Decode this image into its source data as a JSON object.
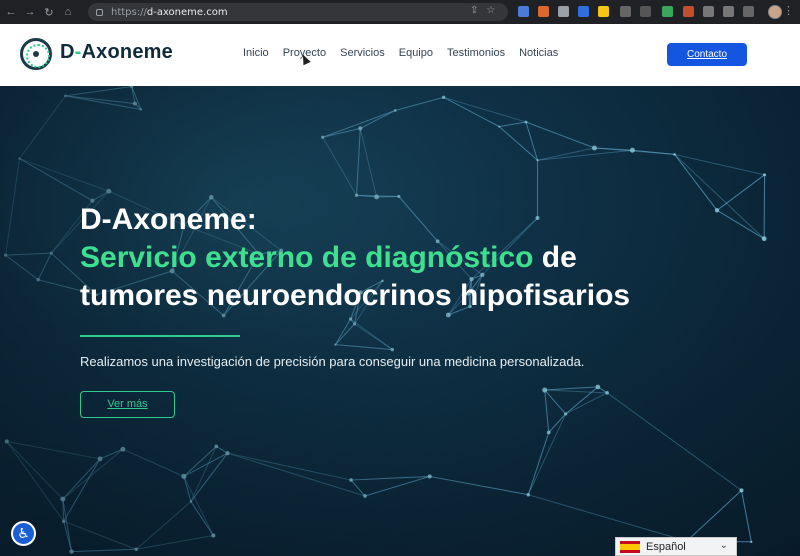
{
  "browser": {
    "url_protocol": "https://",
    "url_host": "d-axoneme.com"
  },
  "site": {
    "logo": {
      "prefix": "D",
      "dash": "-",
      "name": "Axoneme"
    },
    "nav": [
      "Inicio",
      "Proyecto",
      "Servicios",
      "Equipo",
      "Testimonios",
      "Noticias"
    ],
    "cta_label": "Contacto"
  },
  "hero": {
    "title_line1": "D-Axoneme:",
    "title_line2_accent": "Servicio externo de diagnóstico",
    "title_line2_rest": " de",
    "title_line3": "tumores neuroendocrinos hipofisarios",
    "subtitle": "Realizamos una investigación de precisión para conseguir una medicina personalizada.",
    "button_label": "Ver más"
  },
  "language": {
    "label": "Español",
    "chevron": "⌄"
  },
  "colors": {
    "accent": "#2ecc8f",
    "cta": "#1556e0",
    "hero_bg": "#0b2638"
  },
  "icons": [
    "back-icon",
    "forward-icon",
    "reload-icon",
    "home-icon",
    "lock-icon",
    "share-icon",
    "star-icon",
    "accessibility-icon",
    "spain-flag-icon",
    "chevron-down-icon"
  ]
}
